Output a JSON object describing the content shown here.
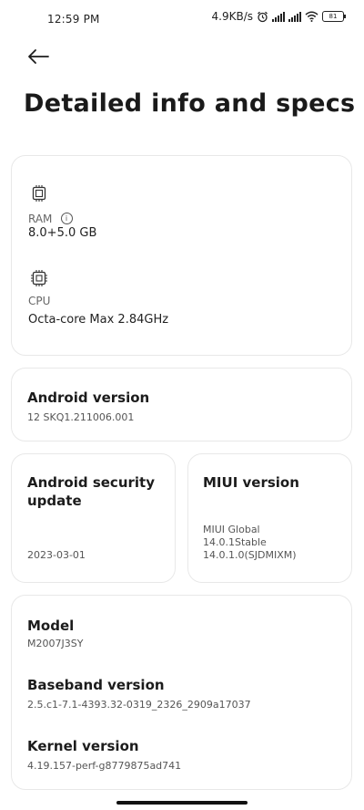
{
  "status_bar": {
    "time": "12:59 PM",
    "net_speed": "4.9KB/s",
    "battery": "81"
  },
  "header": {
    "title": "Detailed info and specs"
  },
  "hardware": {
    "ram_label": "RAM",
    "ram_value": "8.0+5.0 GB",
    "cpu_label": "CPU",
    "cpu_value": "Octa-core Max 2.84GHz"
  },
  "android_version": {
    "label": "Android version",
    "value": "12 SKQ1.211006.001"
  },
  "security_update": {
    "label_line1": "Android security",
    "label_line2": "update",
    "value": "2023-03-01"
  },
  "miui_version": {
    "label": "MIUI version",
    "line1": "MIUI Global",
    "line2": "14.0.1Stable",
    "line3": "14.0.1.0(SJDMIXM)"
  },
  "device": {
    "model_label": "Model",
    "model_value": "M2007J3SY",
    "baseband_label": "Baseband version",
    "baseband_value": "2.5.c1-7.1-4393.32-0319_2326_2909a17037",
    "kernel_label": "Kernel version",
    "kernel_value": "4.19.157-perf-g8779875ad741"
  },
  "icons": {
    "back": "arrow-left",
    "ram": "memory-chip",
    "cpu": "processor-chip",
    "info": "info-circle"
  }
}
